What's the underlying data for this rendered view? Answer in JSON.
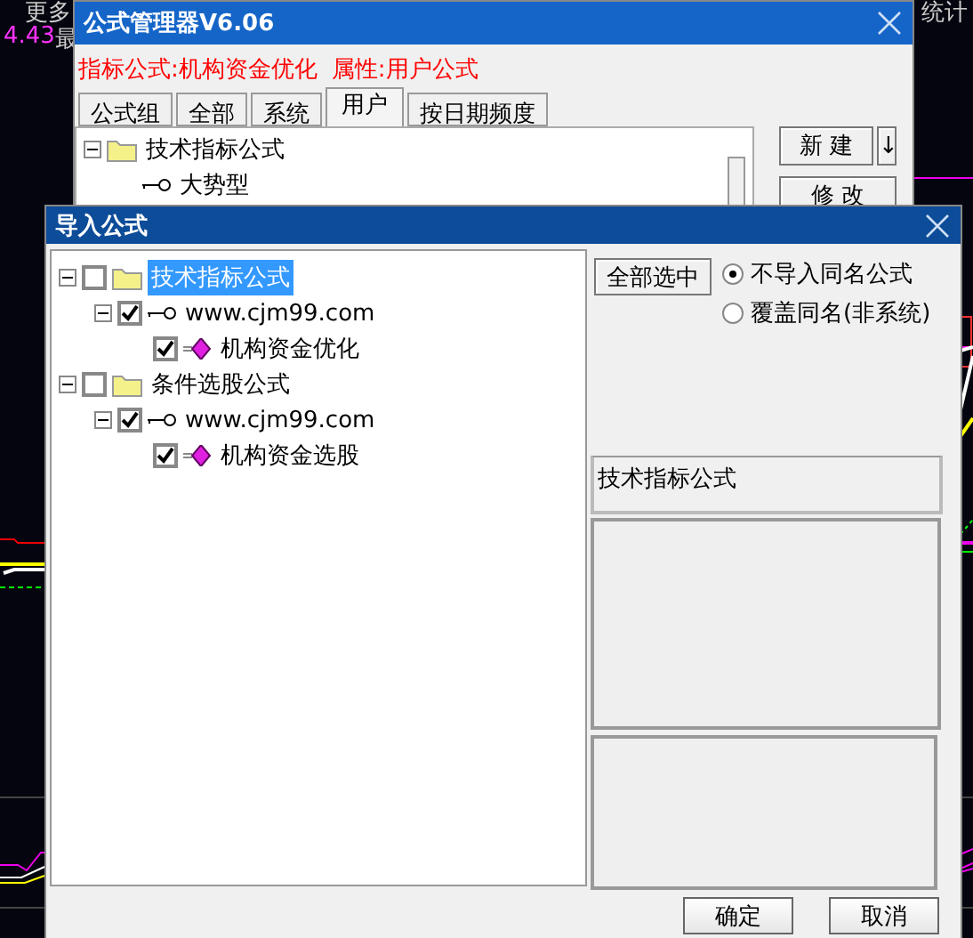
{
  "chart_header": {
    "menu": "更多",
    "price": "4.43",
    "label": "最",
    "right_tab": "统计"
  },
  "manager": {
    "title": "公式管理器V6.06",
    "info": [
      "指标公式:机构资金优化",
      "属性:用户公式"
    ],
    "tabs": [
      {
        "label": "公式组",
        "selected": false
      },
      {
        "label": "全部",
        "selected": false
      },
      {
        "label": "系统",
        "selected": false
      },
      {
        "label": "用户",
        "selected": true
      },
      {
        "label": "按日期频度",
        "selected": false
      }
    ],
    "tree": [
      {
        "label": "技术指标公式",
        "kind": "folder",
        "expanded": true,
        "children": [
          {
            "label": "大势型",
            "kind": "key"
          }
        ]
      }
    ],
    "buttons": [
      {
        "label": "新 建"
      },
      {
        "label": "修 改"
      }
    ],
    "arrow": "↓"
  },
  "import_dialog": {
    "title": "导入公式",
    "tree": [
      {
        "label": "技术指标公式",
        "kind": "folder",
        "checked": false,
        "selected": true,
        "expanded": true,
        "children": [
          {
            "label": "www.cjm99.com",
            "kind": "key",
            "checked": true,
            "selected": false,
            "expanded": true,
            "children": [
              {
                "label": "机构资金优化",
                "kind": "formula",
                "checked": true,
                "selected": false
              }
            ]
          }
        ]
      },
      {
        "label": "条件选股公式",
        "kind": "folder",
        "checked": false,
        "selected": false,
        "expanded": true,
        "children": [
          {
            "label": "www.cjm99.com",
            "kind": "key",
            "checked": true,
            "selected": false,
            "expanded": true,
            "children": [
              {
                "label": "机构资金选股",
                "kind": "formula",
                "checked": true,
                "selected": false
              }
            ]
          }
        ]
      }
    ],
    "select_all": "全部选中",
    "options": [
      {
        "label": "不导入同名公式",
        "selected": true
      },
      {
        "label": "覆盖同名(非系统)",
        "selected": false
      }
    ],
    "description": "技术指标公式",
    "buttons": [
      {
        "label": "确定"
      },
      {
        "label": "取消"
      }
    ]
  }
}
